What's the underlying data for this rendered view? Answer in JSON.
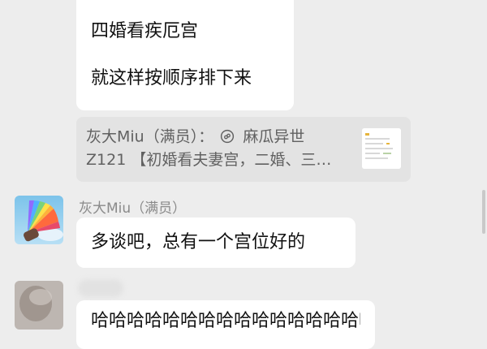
{
  "messages": {
    "top": {
      "lines": [
        "四婚看疾厄宫",
        "就这样按顺序排下来"
      ]
    },
    "quote": {
      "line1_before": "灰大Miu（满员）：",
      "line1_after": "麻瓜异世",
      "line2": "Z121 【初婚看夫妻宫，二婚、三…",
      "icon": "link-icon"
    },
    "reply": {
      "sender": "灰大Miu（满员）",
      "text": "多谈吧，总有一个宫位好的"
    },
    "bottom": {
      "text": "哈哈哈哈哈哈哈哈哈哈哈哈哈哈哈哈"
    }
  },
  "colors": {
    "background": "#ededed",
    "bubble": "#ffffff",
    "quote_bg": "#e3e3e3",
    "sender_text": "#8a8a8a"
  }
}
